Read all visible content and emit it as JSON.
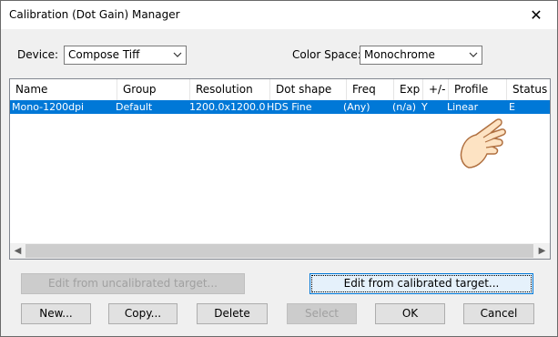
{
  "window": {
    "title": "Calibration (Dot Gain) Manager",
    "close_glyph": "✕"
  },
  "device": {
    "label": "Device:",
    "value": "Compose Tiff"
  },
  "color_space": {
    "label": "Color Space:",
    "value": "Monochrome"
  },
  "table": {
    "columns": [
      "Name",
      "Group",
      "Resolution",
      "Dot shape",
      "Freq",
      "Exp",
      "+/-",
      "Profile",
      "Status"
    ],
    "rows": [
      [
        "Mono-1200dpi",
        "Default",
        "1200.0x1200.0",
        "HDS Fine",
        "(Any)",
        "(n/a)",
        "Y",
        "Linear",
        "E"
      ]
    ]
  },
  "buttons": {
    "edit_uncalibrated": "Edit from uncalibrated target...",
    "edit_calibrated": "Edit from calibrated target...",
    "new": "New...",
    "copy": "Copy...",
    "delete": "Delete",
    "select": "Select",
    "ok": "OK",
    "cancel": "Cancel"
  },
  "colors": {
    "selection": "#0078d7",
    "dialog_bg": "#f0f0f0",
    "accent": "#0078d7"
  },
  "icons": {
    "close": "close-icon",
    "dropdown": "chevron-down-icon",
    "cursor": "hand-pointer-icon"
  }
}
